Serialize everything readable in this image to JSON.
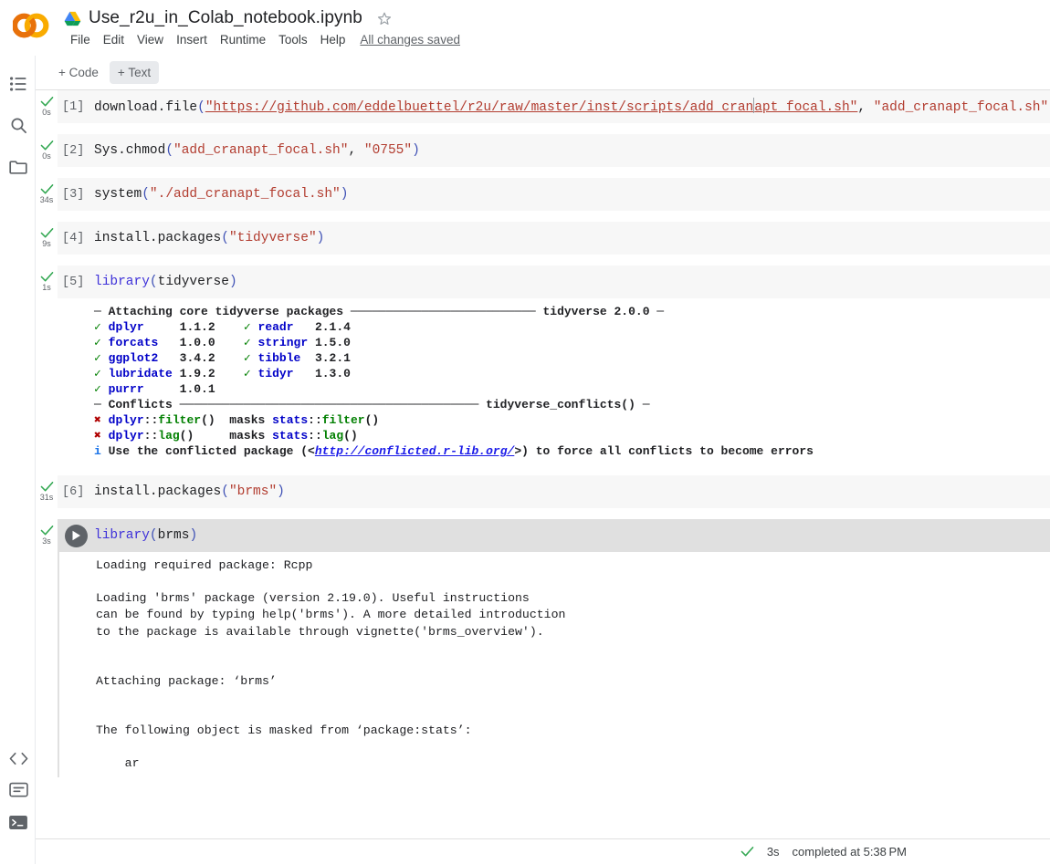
{
  "app": {
    "logo_name": "colab-logo",
    "drive_icon": "drive-icon",
    "star_icon": "star-outline-icon"
  },
  "header": {
    "notebook_title": "Use_r2u_in_Colab_notebook.ipynb",
    "menus": [
      "File",
      "Edit",
      "View",
      "Insert",
      "Runtime",
      "Tools",
      "Help"
    ],
    "save_state": "All changes saved"
  },
  "toolbar": {
    "add_code_label": "+ Code",
    "add_text_label": "+ Text"
  },
  "rail": {
    "items": [
      {
        "name": "table-of-contents-icon"
      },
      {
        "name": "search-icon"
      },
      {
        "name": "files-icon"
      },
      {
        "name": "code-snippets-icon"
      },
      {
        "name": "command-palette-icon"
      },
      {
        "name": "terminal-icon"
      }
    ]
  },
  "cells": [
    {
      "exec_count": "[1]",
      "elapsed": "0s",
      "status": "success",
      "code_parts": [
        {
          "t": "plain",
          "v": "download.file"
        },
        {
          "t": "paren",
          "v": "("
        },
        {
          "t": "string-url",
          "v": "\"https://github.com/eddelbuettel/r2u/raw/master/inst/scripts/add_cranapt_focal.sh\""
        },
        {
          "t": "plain",
          "v": ", "
        },
        {
          "t": "string",
          "v": "\"add_cranapt_focal.sh\""
        },
        {
          "t": "paren",
          "v": ")"
        }
      ]
    },
    {
      "exec_count": "[2]",
      "elapsed": "0s",
      "status": "success",
      "code_parts": [
        {
          "t": "plain",
          "v": "Sys.chmod"
        },
        {
          "t": "paren",
          "v": "("
        },
        {
          "t": "string",
          "v": "\"add_cranapt_focal.sh\""
        },
        {
          "t": "plain",
          "v": ", "
        },
        {
          "t": "string",
          "v": "\"0755\""
        },
        {
          "t": "paren",
          "v": ")"
        }
      ]
    },
    {
      "exec_count": "[3]",
      "elapsed": "34s",
      "status": "success",
      "code_parts": [
        {
          "t": "plain",
          "v": "system"
        },
        {
          "t": "paren",
          "v": "("
        },
        {
          "t": "string",
          "v": "\"./add_cranapt_focal.sh\""
        },
        {
          "t": "paren",
          "v": ")"
        }
      ]
    },
    {
      "exec_count": "[4]",
      "elapsed": "9s",
      "status": "success",
      "code_parts": [
        {
          "t": "plain",
          "v": "install.packages"
        },
        {
          "t": "paren",
          "v": "("
        },
        {
          "t": "string",
          "v": "\"tidyverse\""
        },
        {
          "t": "paren",
          "v": ")"
        }
      ]
    },
    {
      "exec_count": "[5]",
      "elapsed": "1s",
      "status": "success",
      "code_parts": [
        {
          "t": "kw",
          "v": "library"
        },
        {
          "t": "paren",
          "v": "("
        },
        {
          "t": "plain",
          "v": "tidyverse"
        },
        {
          "t": "paren",
          "v": ")"
        }
      ]
    },
    {
      "exec_count": "[6]",
      "elapsed": "31s",
      "status": "success",
      "code_parts": [
        {
          "t": "plain",
          "v": "install.packages"
        },
        {
          "t": "paren",
          "v": "("
        },
        {
          "t": "string",
          "v": "\"brms\""
        },
        {
          "t": "paren",
          "v": ")"
        }
      ]
    },
    {
      "exec_count": "",
      "elapsed": "3s",
      "status": "success",
      "selected": true,
      "code_parts": [
        {
          "t": "kw",
          "v": "library"
        },
        {
          "t": "paren",
          "v": "("
        },
        {
          "t": "plain",
          "v": "brms"
        },
        {
          "t": "paren",
          "v": ")"
        }
      ]
    }
  ],
  "tidyverse_output": {
    "attach_header_left": "Attaching core tidyverse packages",
    "attach_header_right": "tidyverse 2.0.0",
    "packages": [
      {
        "name": "dplyr",
        "version": "1.1.2",
        "name2": "readr",
        "version2": "2.1.4"
      },
      {
        "name": "forcats",
        "version": "1.0.0",
        "name2": "stringr",
        "version2": "1.5.0"
      },
      {
        "name": "ggplot2",
        "version": "3.4.2",
        "name2": "tibble",
        "version2": "3.2.1"
      },
      {
        "name": "lubridate",
        "version": "1.9.2",
        "name2": "tidyr",
        "version2": "1.3.0"
      },
      {
        "name": "purrr",
        "version": "1.0.1",
        "name2": "",
        "version2": ""
      }
    ],
    "conflicts_header_left": "Conflicts",
    "conflicts_header_right": "tidyverse_conflicts()",
    "conflicts": [
      {
        "pkg": "dplyr",
        "fn": "filter",
        "gap": " ",
        "masks": "masks",
        "pkg2": "stats",
        "fn2": "filter"
      },
      {
        "pkg": "dplyr",
        "fn": "lag",
        "gap": "    ",
        "masks": "masks",
        "pkg2": "stats",
        "fn2": "lag"
      }
    ],
    "info_pre": "Use the conflicted package (<",
    "info_link": "http://conflicted.r-lib.org/",
    "info_post": ">) to force all conflicts to become errors"
  },
  "brms_output": {
    "line1": "Loading required package: Rcpp",
    "block1": "Loading 'brms' package (version 2.19.0). Useful instructions\ncan be found by typing help('brms'). A more detailed introduction\nto the package is available through vignette('brms_overview').",
    "block2": "Attaching package: ‘brms’",
    "block3": "The following object is masked from ‘package:stats’:",
    "block4": "    ar"
  },
  "statusbar": {
    "elapsed": "3s",
    "text": "completed at 5:38 PM"
  },
  "colors": {
    "accent": "#1a73e8",
    "success": "#34a853",
    "cell_bg": "#f7f7f7",
    "cell_bg_selected": "#e0e0e0",
    "string": "#b23c2f",
    "keyword": "#3f32d9"
  }
}
